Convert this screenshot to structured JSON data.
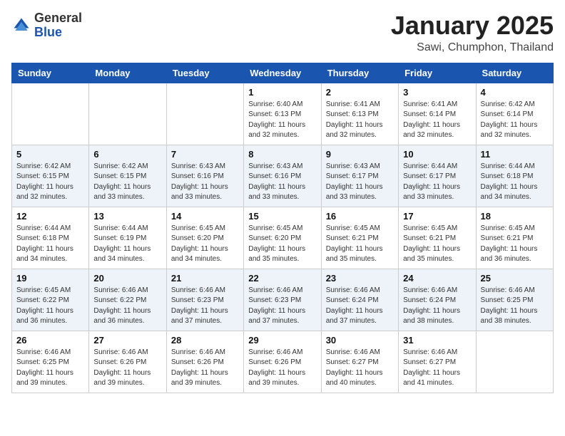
{
  "header": {
    "logo_general": "General",
    "logo_blue": "Blue",
    "month_title": "January 2025",
    "subtitle": "Sawi, Chumphon, Thailand"
  },
  "weekdays": [
    "Sunday",
    "Monday",
    "Tuesday",
    "Wednesday",
    "Thursday",
    "Friday",
    "Saturday"
  ],
  "weeks": [
    [
      {
        "day": "",
        "info": ""
      },
      {
        "day": "",
        "info": ""
      },
      {
        "day": "",
        "info": ""
      },
      {
        "day": "1",
        "info": "Sunrise: 6:40 AM\nSunset: 6:13 PM\nDaylight: 11 hours and 32 minutes."
      },
      {
        "day": "2",
        "info": "Sunrise: 6:41 AM\nSunset: 6:13 PM\nDaylight: 11 hours and 32 minutes."
      },
      {
        "day": "3",
        "info": "Sunrise: 6:41 AM\nSunset: 6:14 PM\nDaylight: 11 hours and 32 minutes."
      },
      {
        "day": "4",
        "info": "Sunrise: 6:42 AM\nSunset: 6:14 PM\nDaylight: 11 hours and 32 minutes."
      }
    ],
    [
      {
        "day": "5",
        "info": "Sunrise: 6:42 AM\nSunset: 6:15 PM\nDaylight: 11 hours and 32 minutes."
      },
      {
        "day": "6",
        "info": "Sunrise: 6:42 AM\nSunset: 6:15 PM\nDaylight: 11 hours and 33 minutes."
      },
      {
        "day": "7",
        "info": "Sunrise: 6:43 AM\nSunset: 6:16 PM\nDaylight: 11 hours and 33 minutes."
      },
      {
        "day": "8",
        "info": "Sunrise: 6:43 AM\nSunset: 6:16 PM\nDaylight: 11 hours and 33 minutes."
      },
      {
        "day": "9",
        "info": "Sunrise: 6:43 AM\nSunset: 6:17 PM\nDaylight: 11 hours and 33 minutes."
      },
      {
        "day": "10",
        "info": "Sunrise: 6:44 AM\nSunset: 6:17 PM\nDaylight: 11 hours and 33 minutes."
      },
      {
        "day": "11",
        "info": "Sunrise: 6:44 AM\nSunset: 6:18 PM\nDaylight: 11 hours and 34 minutes."
      }
    ],
    [
      {
        "day": "12",
        "info": "Sunrise: 6:44 AM\nSunset: 6:18 PM\nDaylight: 11 hours and 34 minutes."
      },
      {
        "day": "13",
        "info": "Sunrise: 6:44 AM\nSunset: 6:19 PM\nDaylight: 11 hours and 34 minutes."
      },
      {
        "day": "14",
        "info": "Sunrise: 6:45 AM\nSunset: 6:20 PM\nDaylight: 11 hours and 34 minutes."
      },
      {
        "day": "15",
        "info": "Sunrise: 6:45 AM\nSunset: 6:20 PM\nDaylight: 11 hours and 35 minutes."
      },
      {
        "day": "16",
        "info": "Sunrise: 6:45 AM\nSunset: 6:21 PM\nDaylight: 11 hours and 35 minutes."
      },
      {
        "day": "17",
        "info": "Sunrise: 6:45 AM\nSunset: 6:21 PM\nDaylight: 11 hours and 35 minutes."
      },
      {
        "day": "18",
        "info": "Sunrise: 6:45 AM\nSunset: 6:21 PM\nDaylight: 11 hours and 36 minutes."
      }
    ],
    [
      {
        "day": "19",
        "info": "Sunrise: 6:45 AM\nSunset: 6:22 PM\nDaylight: 11 hours and 36 minutes."
      },
      {
        "day": "20",
        "info": "Sunrise: 6:46 AM\nSunset: 6:22 PM\nDaylight: 11 hours and 36 minutes."
      },
      {
        "day": "21",
        "info": "Sunrise: 6:46 AM\nSunset: 6:23 PM\nDaylight: 11 hours and 37 minutes."
      },
      {
        "day": "22",
        "info": "Sunrise: 6:46 AM\nSunset: 6:23 PM\nDaylight: 11 hours and 37 minutes."
      },
      {
        "day": "23",
        "info": "Sunrise: 6:46 AM\nSunset: 6:24 PM\nDaylight: 11 hours and 37 minutes."
      },
      {
        "day": "24",
        "info": "Sunrise: 6:46 AM\nSunset: 6:24 PM\nDaylight: 11 hours and 38 minutes."
      },
      {
        "day": "25",
        "info": "Sunrise: 6:46 AM\nSunset: 6:25 PM\nDaylight: 11 hours and 38 minutes."
      }
    ],
    [
      {
        "day": "26",
        "info": "Sunrise: 6:46 AM\nSunset: 6:25 PM\nDaylight: 11 hours and 39 minutes."
      },
      {
        "day": "27",
        "info": "Sunrise: 6:46 AM\nSunset: 6:26 PM\nDaylight: 11 hours and 39 minutes."
      },
      {
        "day": "28",
        "info": "Sunrise: 6:46 AM\nSunset: 6:26 PM\nDaylight: 11 hours and 39 minutes."
      },
      {
        "day": "29",
        "info": "Sunrise: 6:46 AM\nSunset: 6:26 PM\nDaylight: 11 hours and 39 minutes."
      },
      {
        "day": "30",
        "info": "Sunrise: 6:46 AM\nSunset: 6:27 PM\nDaylight: 11 hours and 40 minutes."
      },
      {
        "day": "31",
        "info": "Sunrise: 6:46 AM\nSunset: 6:27 PM\nDaylight: 11 hours and 41 minutes."
      },
      {
        "day": "",
        "info": ""
      }
    ]
  ]
}
